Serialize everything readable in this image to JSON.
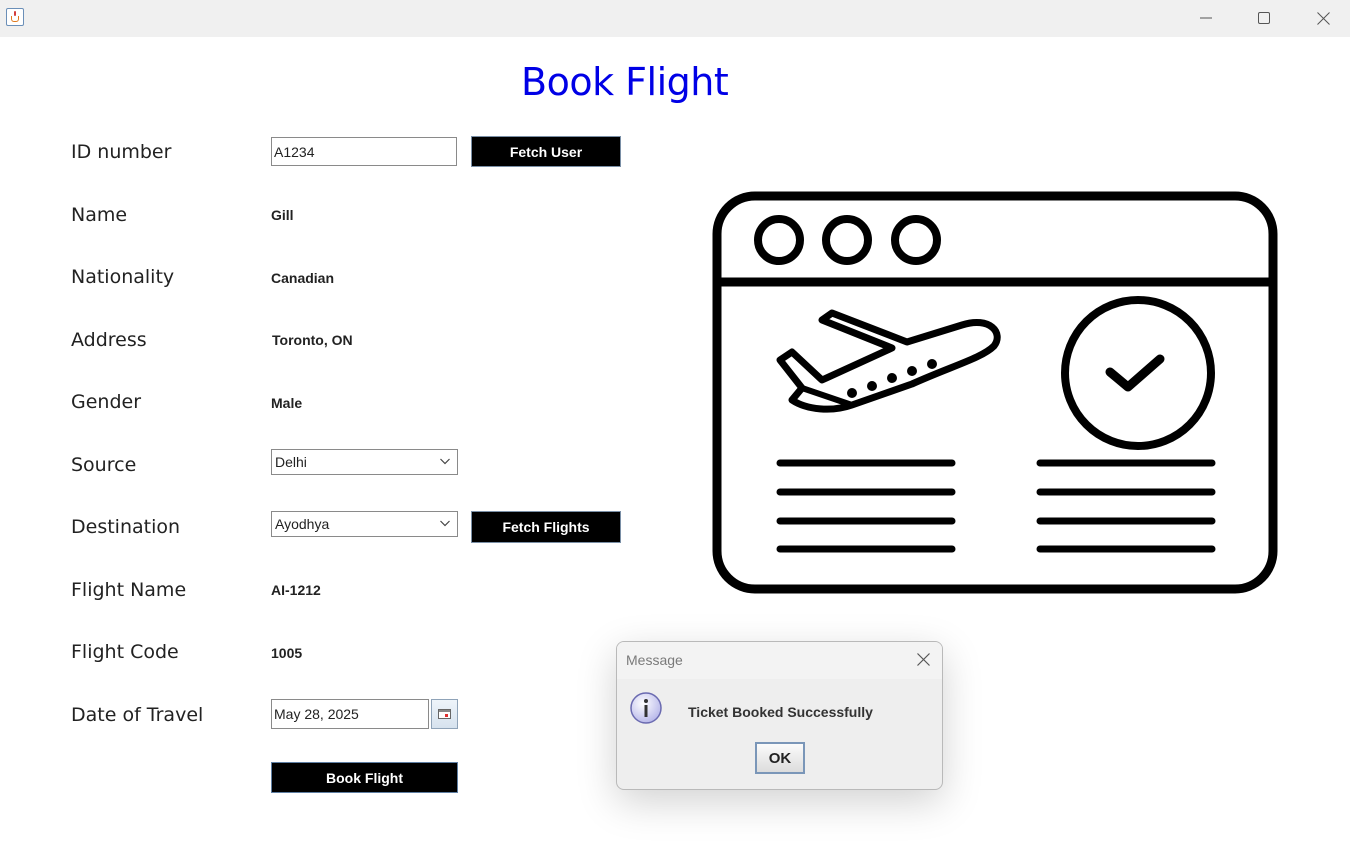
{
  "window": {
    "icon": "java-cup-icon",
    "controls": {
      "minimize": "minimize-icon",
      "maximize": "maximize-icon",
      "close": "close-icon"
    }
  },
  "form": {
    "title": "Book Flight",
    "title_color": "#0000e6",
    "id_label": "ID number",
    "id_value": "A1234",
    "fetch_user_label": "Fetch User",
    "name_label": "Name",
    "name_value": "Gill",
    "nationality_label": "Nationality",
    "nationality_value": "Canadian",
    "address_label": "Address",
    "address_value": "Toronto, ON",
    "gender_label": "Gender",
    "gender_value": "Male",
    "source_label": "Source",
    "source_selected": "Delhi",
    "destination_label": "Destination",
    "destination_selected": "Ayodhya",
    "fetch_flights_label": "Fetch Flights",
    "flight_name_label": "Flight Name",
    "flight_name_value": "AI-1212",
    "flight_code_label": "Flight Code",
    "flight_code_value": "1005",
    "date_label": "Date of Travel",
    "date_value": "May 28, 2025",
    "calendar_icon": "calendar-icon",
    "book_label": "Book Flight"
  },
  "illustration": {
    "name": "flight-booking-illustration",
    "icons": [
      "airplane-icon",
      "check-circle-icon"
    ]
  },
  "dialog": {
    "title": "Message",
    "message": "Ticket Booked Successfully",
    "ok_label": "OK",
    "icon": "info-icon"
  }
}
